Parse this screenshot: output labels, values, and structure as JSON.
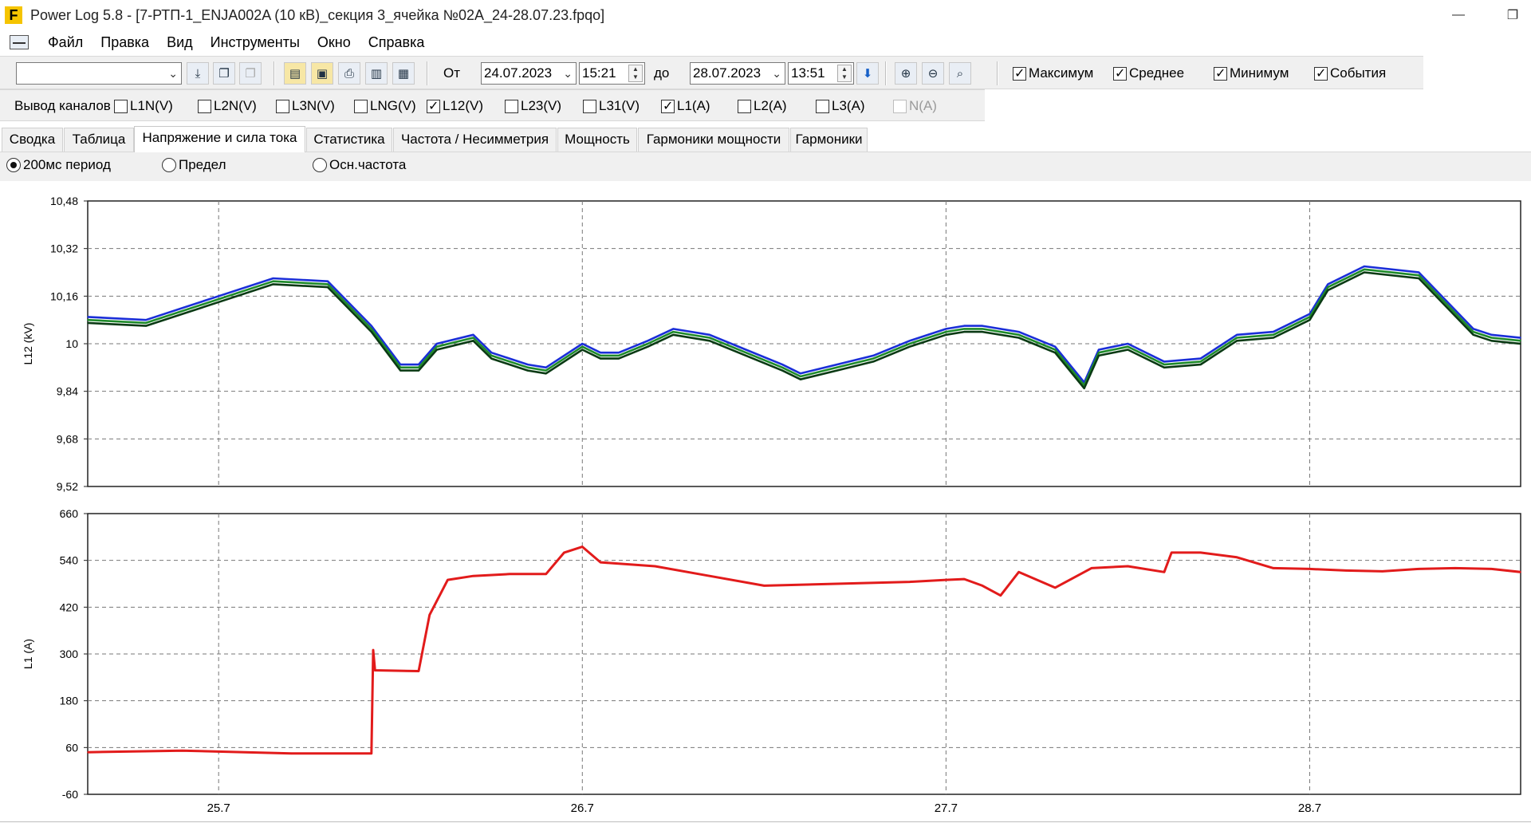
{
  "window": {
    "title": "Power Log 5.8 - [7-РТП-1_ENJA002A (10 кВ)_секция 3_ячейка №02A_24-28.07.23.fpqo]",
    "logo_letter": "F",
    "minimize_glyph": "—",
    "maximize_glyph": "❐"
  },
  "menu": {
    "items": [
      "Файл",
      "Правка",
      "Вид",
      "Инструменты",
      "Окно",
      "Справка"
    ]
  },
  "toolbar": {
    "from_label": "От",
    "from_date": "24.07.2023",
    "from_time": "15:21",
    "to_label": "до",
    "to_date": "28.07.2023",
    "to_time": "13:51",
    "checks": [
      {
        "label": "Максимум",
        "checked": true
      },
      {
        "label": "Среднее",
        "checked": true
      },
      {
        "label": "Минимум",
        "checked": true
      },
      {
        "label": "События",
        "checked": true
      }
    ]
  },
  "channels": {
    "label": "Вывод каналов",
    "items": [
      {
        "label": "L1N(V)",
        "checked": false,
        "enabled": true
      },
      {
        "label": "L2N(V)",
        "checked": false,
        "enabled": true
      },
      {
        "label": "L3N(V)",
        "checked": false,
        "enabled": true
      },
      {
        "label": "LNG(V)",
        "checked": false,
        "enabled": true
      },
      {
        "label": "L12(V)",
        "checked": true,
        "enabled": true
      },
      {
        "label": "L23(V)",
        "checked": false,
        "enabled": true
      },
      {
        "label": "L31(V)",
        "checked": false,
        "enabled": true
      },
      {
        "label": "L1(A)",
        "checked": true,
        "enabled": true
      },
      {
        "label": "L2(A)",
        "checked": false,
        "enabled": true
      },
      {
        "label": "L3(A)",
        "checked": false,
        "enabled": true
      },
      {
        "label": "N(A)",
        "checked": false,
        "enabled": false
      }
    ]
  },
  "tabs": {
    "items": [
      "Сводка",
      "Таблица",
      "Напряжение и сила тока",
      "Статистика",
      "Частота / Несимметрия",
      "Мощность",
      "Гармоники мощности",
      "Гармоники"
    ],
    "active": 2
  },
  "mode": {
    "options": [
      "200мс период",
      "Предел",
      "Осн.частота"
    ],
    "selected": 0
  },
  "icons": [
    "dropdown-chevron-icon",
    "download-icon",
    "copy-icon",
    "copy-disabled-icon",
    "open-file-icon",
    "save-icon",
    "print-icon",
    "print-preview-icon",
    "export-icon",
    "apply-arrow-icon",
    "zoom-in-icon",
    "zoom-out-icon",
    "zoom-fit-icon",
    "minimize-icon",
    "maximize-icon"
  ],
  "colors": {
    "voltage_max": "#1a2ed8",
    "voltage_avg": "#1e8a2a",
    "voltage_min": "#0a3a14",
    "current": "#e21b1b",
    "current_min": "#7a1a10"
  },
  "chart_data": [
    {
      "type": "line",
      "ylabel": "L12 (kV)",
      "yticks": [
        "10,48",
        "10,32",
        "10,16",
        "10",
        "9,84",
        "9,68",
        "9,52"
      ],
      "ylim": [
        9.52,
        10.48
      ],
      "xticks": [
        "25.7",
        "26.7",
        "27.7",
        "28.7"
      ],
      "xlim_days": [
        24.64,
        28.58
      ],
      "xtick_days": [
        25,
        26,
        27,
        28
      ],
      "grid": true,
      "series": [
        {
          "name": "Максимум",
          "color": "#1a2ed8",
          "x": [
            24.64,
            24.8,
            25.0,
            25.15,
            25.3,
            25.42,
            25.5,
            25.55,
            25.6,
            25.7,
            25.75,
            25.8,
            25.85,
            25.9,
            26.0,
            26.05,
            26.1,
            26.18,
            26.25,
            26.35,
            26.45,
            26.55,
            26.6,
            26.7,
            26.8,
            26.9,
            27.0,
            27.05,
            27.1,
            27.2,
            27.3,
            27.38,
            27.42,
            27.5,
            27.6,
            27.7,
            27.8,
            27.9,
            28.0,
            28.05,
            28.15,
            28.3,
            28.45,
            28.5,
            28.58
          ],
          "y": [
            10.09,
            10.08,
            10.16,
            10.22,
            10.21,
            10.06,
            9.93,
            9.93,
            10.0,
            10.03,
            9.97,
            9.95,
            9.93,
            9.92,
            10.0,
            9.97,
            9.97,
            10.01,
            10.05,
            10.03,
            9.98,
            9.93,
            9.9,
            9.93,
            9.96,
            10.01,
            10.05,
            10.06,
            10.06,
            10.04,
            9.99,
            9.87,
            9.98,
            10.0,
            9.94,
            9.95,
            10.03,
            10.04,
            10.1,
            10.2,
            10.26,
            10.24,
            10.05,
            10.03,
            10.02
          ]
        },
        {
          "name": "Среднее",
          "color": "#1e8a2a",
          "x": [
            24.64,
            24.8,
            25.0,
            25.15,
            25.3,
            25.42,
            25.5,
            25.55,
            25.6,
            25.7,
            25.75,
            25.8,
            25.85,
            25.9,
            26.0,
            26.05,
            26.1,
            26.18,
            26.25,
            26.35,
            26.45,
            26.55,
            26.6,
            26.7,
            26.8,
            26.9,
            27.0,
            27.05,
            27.1,
            27.2,
            27.3,
            27.38,
            27.42,
            27.5,
            27.6,
            27.7,
            27.8,
            27.9,
            28.0,
            28.05,
            28.15,
            28.3,
            28.45,
            28.5,
            28.58
          ],
          "y": [
            10.08,
            10.07,
            10.15,
            10.21,
            10.2,
            10.05,
            9.92,
            9.92,
            9.99,
            10.02,
            9.96,
            9.94,
            9.92,
            9.91,
            9.99,
            9.96,
            9.96,
            10.0,
            10.04,
            10.02,
            9.97,
            9.92,
            9.89,
            9.92,
            9.95,
            10.0,
            10.04,
            10.05,
            10.05,
            10.03,
            9.98,
            9.86,
            9.97,
            9.99,
            9.93,
            9.94,
            10.02,
            10.03,
            10.09,
            10.19,
            10.25,
            10.23,
            10.04,
            10.02,
            10.01
          ]
        },
        {
          "name": "Минимум",
          "color": "#0a3a14",
          "x": [
            24.64,
            24.8,
            25.0,
            25.15,
            25.3,
            25.42,
            25.5,
            25.55,
            25.6,
            25.7,
            25.75,
            25.8,
            25.85,
            25.9,
            26.0,
            26.05,
            26.1,
            26.18,
            26.25,
            26.35,
            26.45,
            26.55,
            26.6,
            26.7,
            26.8,
            26.9,
            27.0,
            27.05,
            27.1,
            27.2,
            27.3,
            27.38,
            27.42,
            27.5,
            27.6,
            27.7,
            27.8,
            27.9,
            28.0,
            28.05,
            28.15,
            28.3,
            28.45,
            28.5,
            28.58
          ],
          "y": [
            10.07,
            10.06,
            10.14,
            10.2,
            10.19,
            10.04,
            9.91,
            9.91,
            9.98,
            10.01,
            9.95,
            9.93,
            9.91,
            9.9,
            9.98,
            9.95,
            9.95,
            9.99,
            10.03,
            10.01,
            9.96,
            9.91,
            9.88,
            9.91,
            9.94,
            9.99,
            10.03,
            10.04,
            10.04,
            10.02,
            9.97,
            9.85,
            9.96,
            9.98,
            9.92,
            9.93,
            10.01,
            10.02,
            10.08,
            10.18,
            10.24,
            10.22,
            10.03,
            10.01,
            10.0
          ]
        }
      ]
    },
    {
      "type": "line",
      "ylabel": "L1 (A)",
      "yticks": [
        "660",
        "540",
        "420",
        "300",
        "180",
        "60",
        "-60"
      ],
      "ylim": [
        -60,
        660
      ],
      "xticks": [
        "25.7",
        "26.7",
        "27.7",
        "28.7"
      ],
      "xlim_days": [
        24.64,
        28.58
      ],
      "xtick_days": [
        25,
        26,
        27,
        28
      ],
      "grid": true,
      "series": [
        {
          "name": "Среднее",
          "color": "#e21b1b",
          "x": [
            24.64,
            24.9,
            25.2,
            25.42,
            25.425,
            25.43,
            25.55,
            25.58,
            25.63,
            25.7,
            25.8,
            25.9,
            25.95,
            26.0,
            26.05,
            26.2,
            26.35,
            26.5,
            26.7,
            26.9,
            27.0,
            27.05,
            27.1,
            27.15,
            27.2,
            27.3,
            27.4,
            27.5,
            27.6,
            27.62,
            27.7,
            27.8,
            27.9,
            28.0,
            28.1,
            28.2,
            28.3,
            28.4,
            28.5,
            28.58
          ],
          "y": [
            48,
            52,
            45,
            45,
            310,
            258,
            256,
            400,
            490,
            500,
            505,
            505,
            560,
            575,
            535,
            525,
            500,
            475,
            480,
            485,
            490,
            492,
            475,
            450,
            510,
            470,
            520,
            525,
            510,
            560,
            560,
            548,
            520,
            518,
            514,
            512,
            518,
            520,
            518,
            510
          ]
        }
      ]
    }
  ]
}
